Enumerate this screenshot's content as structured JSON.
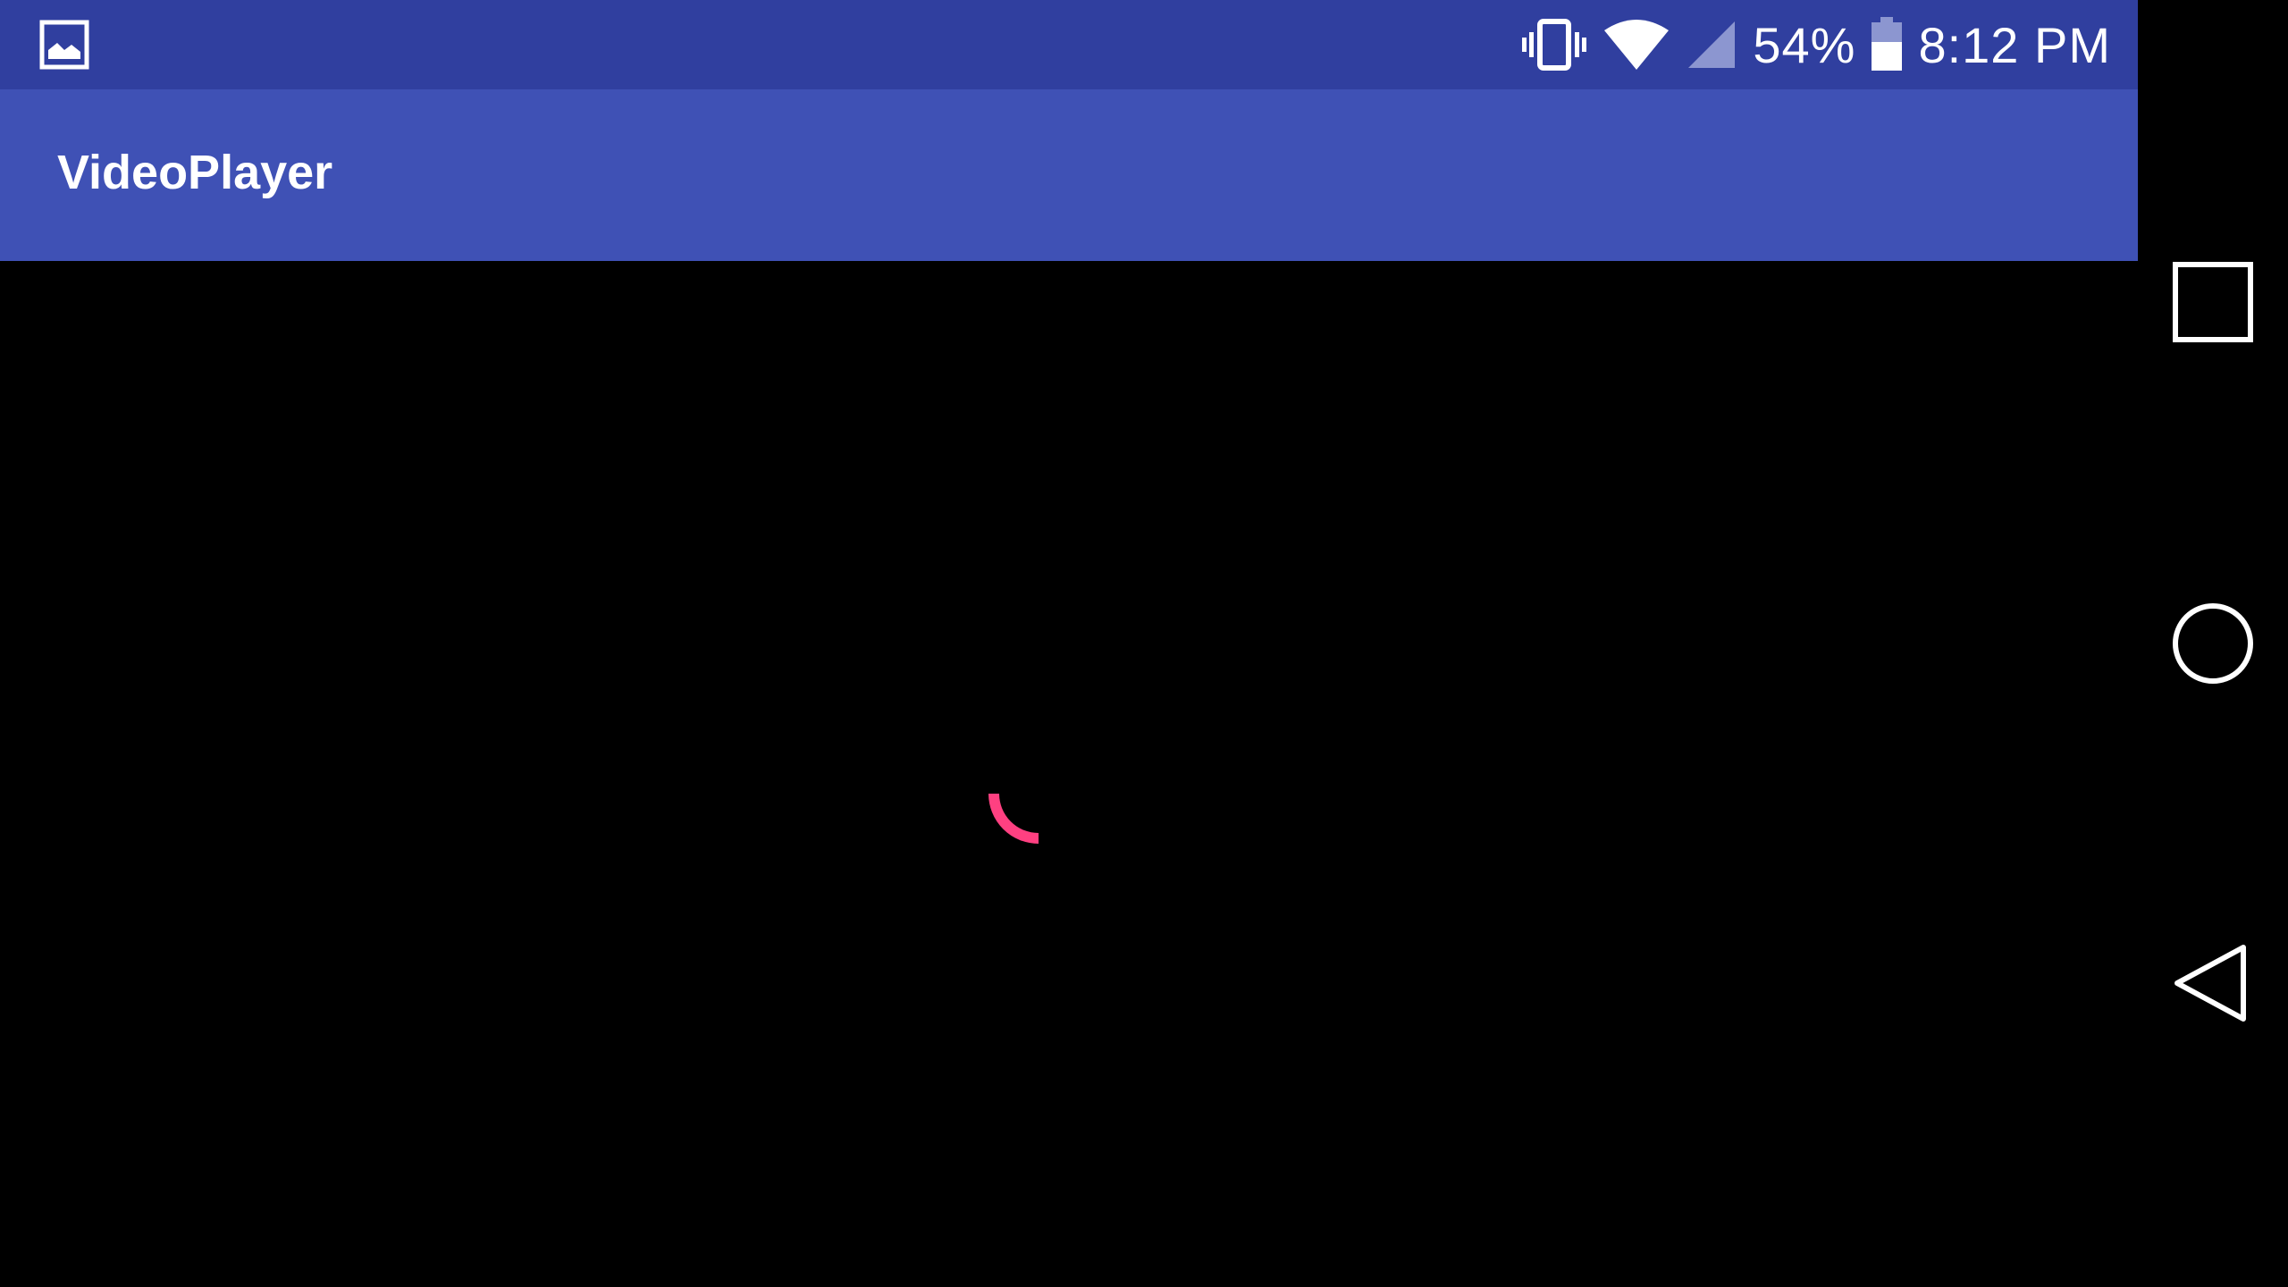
{
  "status_bar": {
    "background": "#303F9F",
    "notification_icon": "image-icon",
    "icons": [
      "vibrate-icon",
      "wifi-icon",
      "cell-signal-icon",
      "battery-icon"
    ],
    "battery_percent": "54%",
    "time": "8:12 PM"
  },
  "app_bar": {
    "title": "VideoPlayer",
    "background": "#3F51B5"
  },
  "content": {
    "background": "#000000",
    "loading_indicator": "spinner-icon",
    "spinner_color": "#FF4081"
  },
  "nav_bar": {
    "buttons": [
      "recents-icon",
      "home-icon",
      "back-icon"
    ]
  }
}
